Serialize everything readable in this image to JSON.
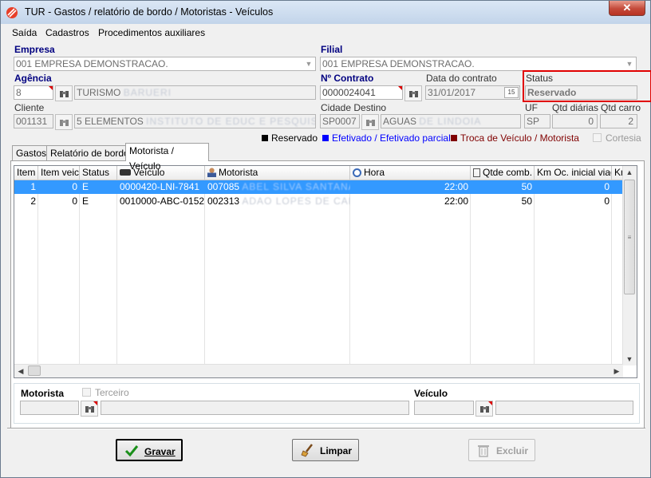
{
  "window": {
    "title": "TUR - Gastos / relatório de bordo / Motoristas - Veículos",
    "close_label": "✕"
  },
  "menu": [
    "Saída",
    "Cadastros",
    "Procedimentos auxiliares"
  ],
  "form": {
    "empresa_label": "Empresa",
    "empresa_value": "001 EMPRESA DEMONSTRACAO.",
    "filial_label": "Filial",
    "filial_value": "001 EMPRESA DEMONSTRACAO.",
    "agencia_label": "Agência",
    "agencia_code": "8",
    "agencia_name": "TURISMO",
    "agencia_name_hidden": "BARUERI",
    "contrato_label": "Nº Contrato",
    "contrato_value": "0000024041",
    "data_contrato_label": "Data do contrato",
    "data_contrato_value": "31/01/2017",
    "status_label": "Status",
    "status_value": "Reservado",
    "cliente_label": "Cliente",
    "cliente_code": "001131",
    "cliente_name": "5 ELEMENTOS",
    "cliente_name_hidden": "INSTITUTO DE EDUC E PESQUISA AMBIEN",
    "cidade_label": "Cidade Destino",
    "cidade_code": "SP0007",
    "cidade_name": "AGUAS",
    "cidade_name_hidden": "DE LINDOIA",
    "uf_label": "UF",
    "uf_value": "SP",
    "qtd_diarias_label": "Qtd diárias",
    "qtd_diarias_value": "0",
    "qtd_carro_label": "Qtd carro",
    "qtd_carro_value": "2"
  },
  "legend": {
    "reservado": "Reservado",
    "efetivado": "Efetivado / Efetivado parcial",
    "troca": "Troca de Veículo / Motorista",
    "cortesia": "Cortesia",
    "colors": {
      "reservado": "#000000",
      "efetivado": "#0000ff",
      "troca": "#800000"
    }
  },
  "tabs": [
    "Gastos",
    "Relatório de bordo",
    "Motorista / Veículo"
  ],
  "grid": {
    "headers": [
      "Item",
      "Item veic",
      "Status",
      "Veículo",
      "Motorista",
      "Hora",
      "Qtde comb.",
      "Km Oc. inicial viag.",
      "Km"
    ],
    "rows": [
      {
        "item": "1",
        "item_veic": "0",
        "status": "E",
        "veiculo": "0000420-LNI-7841",
        "motorista_code": "007085",
        "motorista_name": "ABEL SILVA SANTANA",
        "hora": "22:00",
        "qtde": "50",
        "km": "0"
      },
      {
        "item": "2",
        "item_veic": "0",
        "status": "E",
        "veiculo": "0010000-ABC-0152",
        "motorista_code": "002313",
        "motorista_name": "ADAO LOPES DE CARVA",
        "hora": "22:00",
        "qtde": "50",
        "km": "0"
      }
    ]
  },
  "detail": {
    "motorista_label": "Motorista",
    "terceiro_label": "Terceiro",
    "veiculo_label": "Veículo"
  },
  "buttons": {
    "gravar": "Gravar",
    "limpar": "Limpar",
    "excluir": "Excluir"
  }
}
